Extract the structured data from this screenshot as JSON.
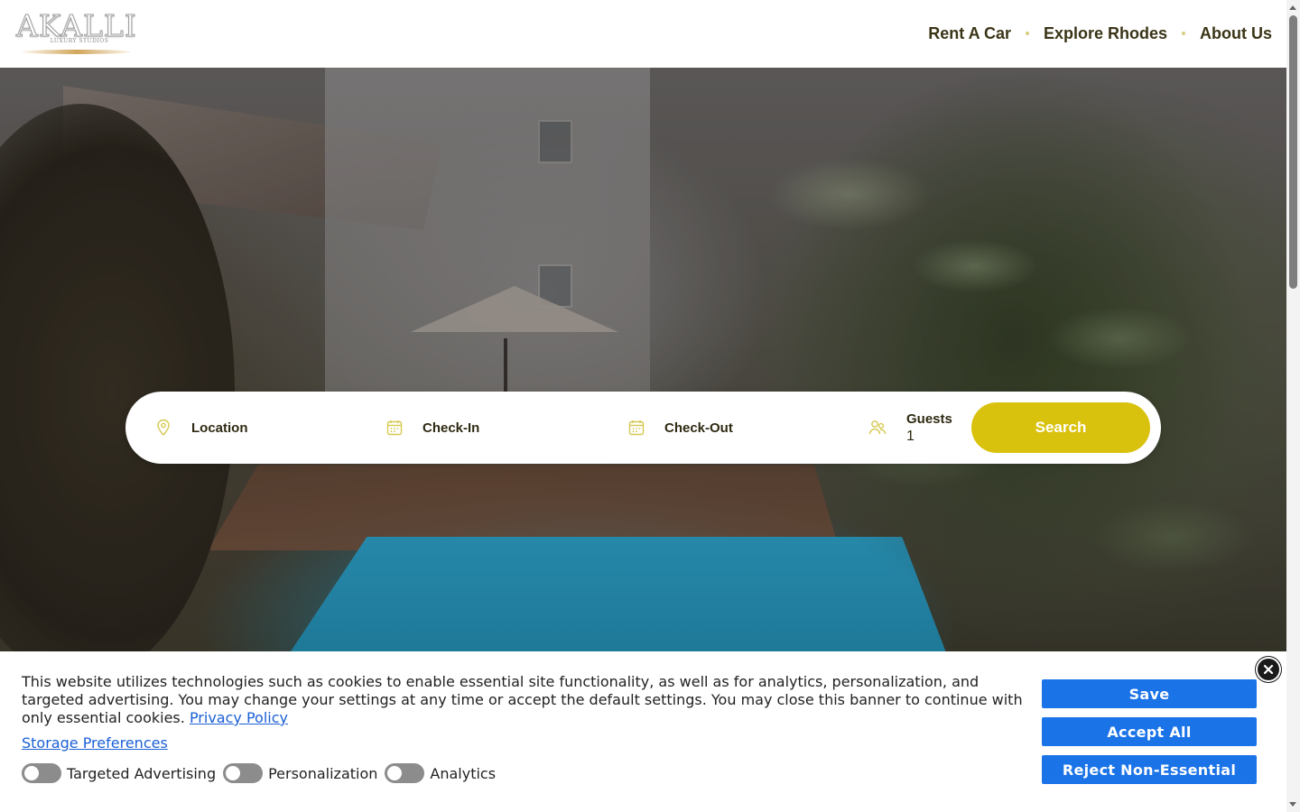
{
  "header": {
    "logo": {
      "name": "AKALLI",
      "tagline": "LUXURY STUDIOS"
    },
    "nav": [
      {
        "label": "Rent A Car"
      },
      {
        "label": "Explore Rhodes"
      },
      {
        "label": "About Us"
      }
    ]
  },
  "search": {
    "location_label": "Location",
    "checkin_label": "Check-In",
    "checkout_label": "Check-Out",
    "guests_label": "Guests",
    "guests_value": "1",
    "search_button": "Search",
    "icons": {
      "location": "map-pin-icon",
      "checkin": "calendar-icon",
      "checkout": "calendar-icon",
      "guests": "users-icon"
    }
  },
  "cookie_banner": {
    "text": "This website utilizes technologies such as cookies to enable essential site functionality, as well as for analytics, personalization, and targeted advertising. You may change your settings at any time or accept the default settings. You may close this banner to continue with only essential cookies.",
    "privacy_link": "Privacy Policy",
    "storage_link": "Storage Preferences",
    "toggles": [
      {
        "label": "Targeted Advertising",
        "on": false
      },
      {
        "label": "Personalization",
        "on": false
      },
      {
        "label": "Analytics",
        "on": false
      }
    ],
    "buttons": {
      "save": "Save",
      "accept_all": "Accept All",
      "reject": "Reject Non-Essential"
    }
  },
  "colors": {
    "accent_yellow": "#d9c20d",
    "nav_text": "#3a3416",
    "cookie_button_blue": "#1b73e8",
    "link_blue": "#1a5fd6"
  }
}
